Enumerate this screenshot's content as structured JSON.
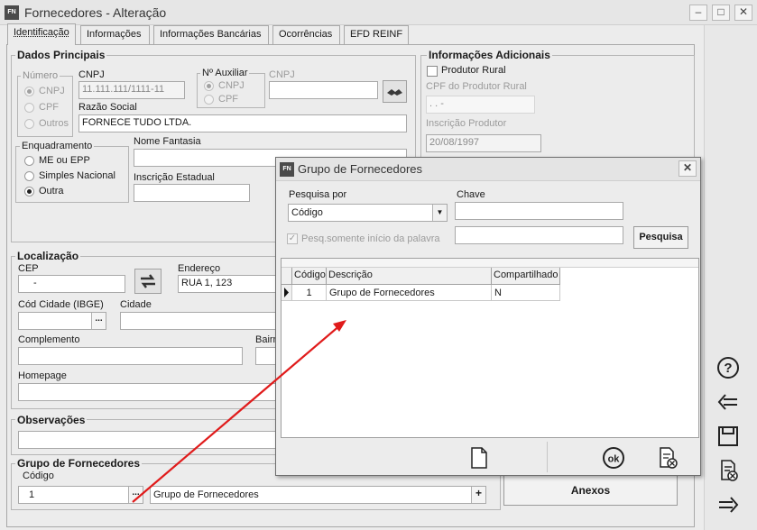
{
  "window": {
    "app_badge": "FN",
    "title": "Fornecedores - Alteração"
  },
  "tabs": [
    {
      "label": "Identificação"
    },
    {
      "label": "Informações"
    },
    {
      "label": "Informações Bancárias"
    },
    {
      "label": "Ocorrências"
    },
    {
      "label": "EFD REINF"
    }
  ],
  "dados_principais": {
    "title": "Dados Principais",
    "numero": {
      "title": "Número",
      "options": [
        "CNPJ",
        "CPF",
        "Outros"
      ]
    },
    "cnpj_label": "CNPJ",
    "cnpj_value": "11.111.111/1111-11",
    "razao_social_label": "Razão Social",
    "razao_social_value": "FORNECE TUDO LTDA.",
    "aux": {
      "title": "Nº Auxiliar",
      "options": [
        "CNPJ",
        "CPF"
      ]
    },
    "cnpj_aux_label": "CNPJ",
    "cnpj_aux_value": "",
    "enquadramento": {
      "title": "Enquadramento",
      "options": [
        "ME ou EPP",
        "Simples Nacional",
        "Outra"
      ],
      "selected": "Outra"
    },
    "nome_fantasia_label": "Nome Fantasia",
    "nome_fantasia_value": "",
    "inscricao_estadual_label": "Inscrição Estadual",
    "inscricao_estadual_value": ""
  },
  "informacoes_adicionais": {
    "title": "Informações Adicionais",
    "produtor_rural_label": "Produtor Rural",
    "produtor_rural_checked": false,
    "cpf_produtor_label": "CPF do Produtor Rural",
    "cpf_produtor_value": ".   .   -",
    "inscricao_produtor_label": "Inscrição Produtor",
    "inscricao_produtor_value": "20/08/1997"
  },
  "localizacao": {
    "title": "Localização",
    "cep_label": "CEP",
    "cep_value": "-",
    "endereco_label": "Endereço",
    "endereco_value": "RUA 1, 123",
    "cod_cidade_label": "Cód Cidade (IBGE)",
    "cod_cidade_value": "",
    "cidade_label": "Cidade",
    "cidade_value": "",
    "complemento_label": "Complemento",
    "complemento_value": "",
    "bairro_label": "Bairro",
    "bairro_value": "",
    "homepage_label": "Homepage",
    "homepage_value": ""
  },
  "observacoes": {
    "title": "Observações",
    "value": ""
  },
  "grupo_fornecedores": {
    "title": "Grupo de Fornecedores",
    "codigo_label": "Código",
    "codigo_value": "1",
    "descricao_value": "Grupo de Fornecedores",
    "dots_label": "...",
    "plus_label": "+"
  },
  "anexos_label": "Anexos",
  "modal": {
    "badge": "FN",
    "title": "Grupo de Fornecedores",
    "close_label": "✕",
    "pesquisa_por_label": "Pesquisa por",
    "pesquisa_por_value": "Código",
    "chave_label": "Chave",
    "chave_value": "",
    "chave2_value": "",
    "pesq_checkbox_label": "Pesq.somente início da palavra",
    "pesq_checkbox_checked": true,
    "pesquisa_button": "Pesquisa",
    "columns": [
      "Código",
      "Descrição",
      "Compartilhado"
    ],
    "rows": [
      {
        "codigo": "1",
        "descricao": "Grupo de Fornecedores",
        "compartilhado": "N"
      }
    ],
    "ok_label": "ok"
  },
  "colors": {
    "arrow": "#e01b1b",
    "title_bar": "#e6e6e6",
    "panel": "#ececec"
  },
  "toolbar_icons": [
    "help-icon",
    "back-arrow-icon",
    "save-icon",
    "delete-doc-icon",
    "forward-arrow-icon"
  ]
}
